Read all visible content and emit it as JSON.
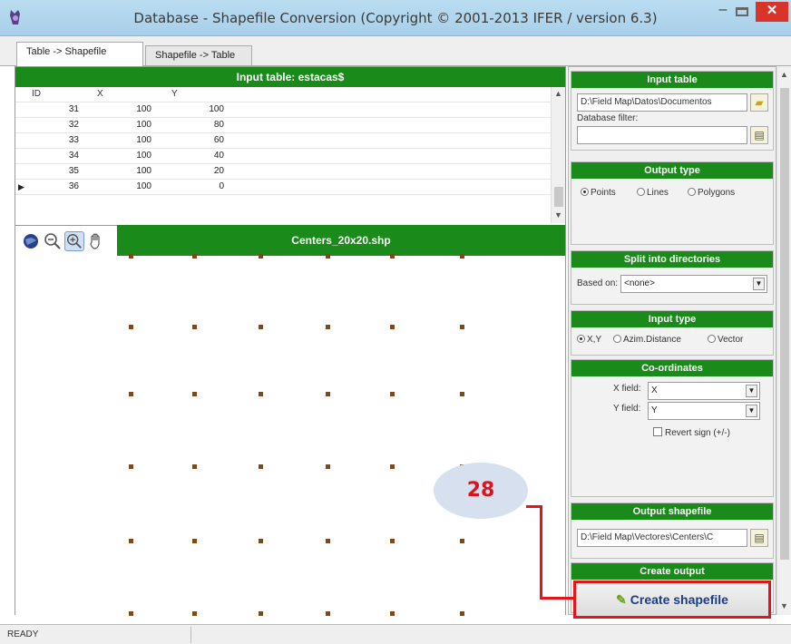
{
  "window": {
    "title": "Database - Shapefile Conversion (Copyright © 2001-2013 IFER / version 6.3)",
    "minimize": "–",
    "close": "✕"
  },
  "tabs": [
    {
      "label": "Table -> Shapefile",
      "active": true
    },
    {
      "label": "Shapefile -> Table",
      "active": false
    }
  ],
  "input_table_panel": {
    "header": "Input table: estacas$",
    "columns": [
      "ID",
      "X",
      "Y"
    ],
    "rows": [
      {
        "id": "31",
        "x": "100",
        "y": "100"
      },
      {
        "id": "32",
        "x": "100",
        "y": "80"
      },
      {
        "id": "33",
        "x": "100",
        "y": "60"
      },
      {
        "id": "34",
        "x": "100",
        "y": "40"
      },
      {
        "id": "35",
        "x": "100",
        "y": "20"
      },
      {
        "id": "36",
        "x": "100",
        "y": "0"
      }
    ],
    "current_row_indicator": "▶"
  },
  "map": {
    "title": "Centers_20x20.shp",
    "tools": [
      "globe-icon",
      "zoom-out-icon",
      "zoom-in-icon",
      "pan-hand-icon"
    ]
  },
  "sidebar": {
    "input_table": {
      "header": "Input table",
      "path": "D:\\Field Map\\Datos\\Documentos",
      "filter_label": "Database filter:",
      "filter_value": ""
    },
    "output_type": {
      "header": "Output type",
      "options": [
        "Points",
        "Lines",
        "Polygons"
      ],
      "selected": "Points"
    },
    "split": {
      "header": "Split into directories",
      "label": "Based on:",
      "value": "<none>"
    },
    "input_type": {
      "header": "Input type",
      "options": [
        "X,Y",
        "Azim.Distance",
        "Vector"
      ],
      "selected": "X,Y"
    },
    "coordinates": {
      "header": "Co-ordinates",
      "xfield_label": "X field:",
      "xfield_value": "X",
      "yfield_label": "Y field:",
      "yfield_value": "Y",
      "revert_label": "Revert sign (+/-)"
    },
    "output_shapefile": {
      "header": "Output shapefile",
      "path": "D:\\Field Map\\Vectores\\Centers\\C"
    },
    "create_output": {
      "header": "Create output",
      "button_label": "Create shapefile"
    }
  },
  "status": {
    "text": "READY"
  },
  "annotation": {
    "step_number": "28",
    "color": "#e2141c"
  }
}
